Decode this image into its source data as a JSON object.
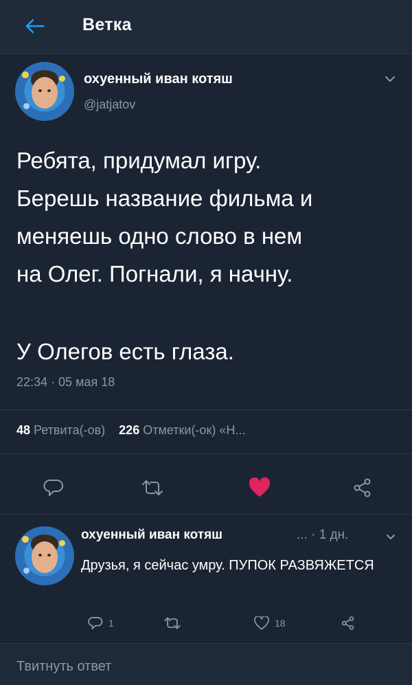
{
  "header": {
    "title": "Ветка",
    "back_icon": "arrow-left-icon"
  },
  "tweet": {
    "author_name": "охуенный иван котяш",
    "author_handle": "@jatjatov",
    "text_lines": [
      "Ребята, придумал игру.",
      "Берешь название фильма и",
      "меняешь одно слово в нем",
      "на Олег. Погнали, я начну.",
      "У Олегов есть глаза."
    ],
    "timestamp": "22:34 · 05 мая 18",
    "retweets_count": "48",
    "retweets_label": "Ретвита(-ов)",
    "likes_count": "226",
    "likes_label": "Отметки(-ок)",
    "stats_tail": "«Н...",
    "accent": "#e0245e"
  },
  "reply": {
    "author_name": "охуенный иван котяш",
    "meta": "... · 1 дн.",
    "text": "Друзья, я сейчас умру. ПУПОК РАЗВЯЖЕТСЯ",
    "reply_count": "1",
    "like_count": "18"
  },
  "composer": {
    "placeholder": "Твитнуть ответ"
  }
}
